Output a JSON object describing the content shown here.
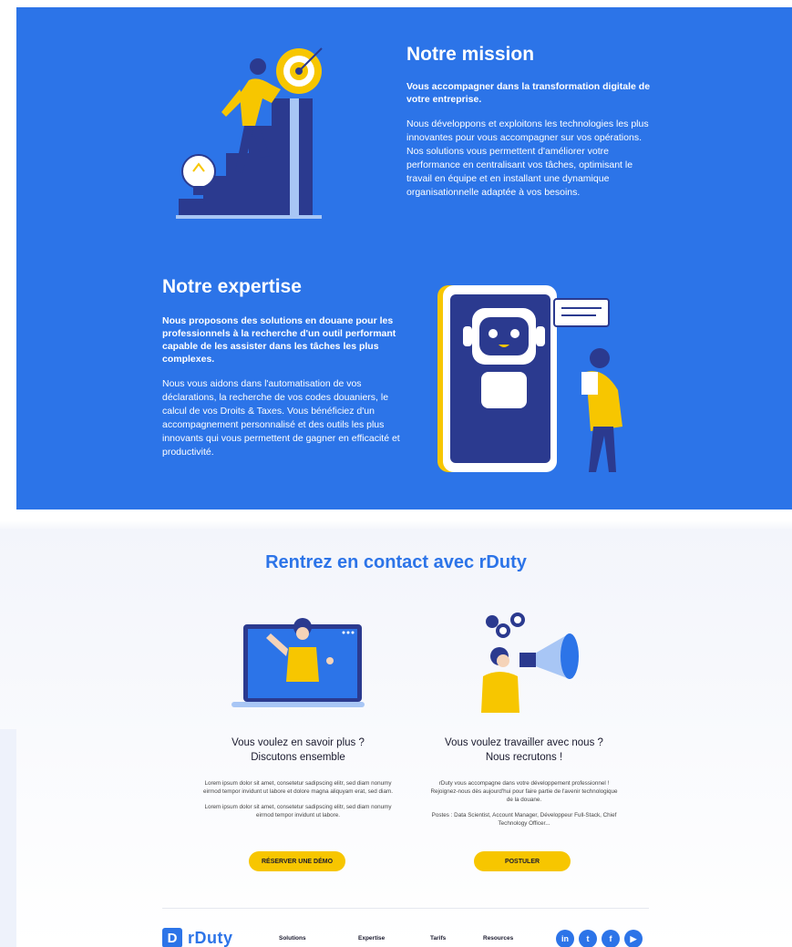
{
  "mission": {
    "title": "Notre mission",
    "lead": "Vous accompagner dans la transformation digitale de votre entreprise.",
    "body": "Nous développons et exploitons les technologies les plus innovantes pour vous accompagner sur vos opérations. Nos solutions vous permettent d'améliorer votre performance en centralisant vos tâches, optimisant le travail en équipe et en installant une dynamique organisationnelle adaptée à vos besoins."
  },
  "expertise": {
    "title": "Notre expertise",
    "lead": "Nous proposons des solutions en douane pour les professionnels à la recherche d'un outil performant capable de les assister dans les tâches les plus complexes.",
    "body": "Nous vous aidons dans l'automatisation de vos déclarations, la recherche de vos codes douaniers, le calcul de vos Droits & Taxes. Vous bénéficiez d'un accompagnement personnalisé et des outils les plus innovants qui vous permettent de gagner en efficacité et productivité."
  },
  "contact": {
    "title": "Rentrez en contact avec rDuty",
    "left": {
      "title_line1": "Vous voulez en savoir plus ?",
      "title_line2": "Discutons ensemble",
      "para1": "Lorem ipsum dolor sit amet, consetetur sadipscing elitr, sed diam nonumy eirmod tempor invidunt ut labore et dolore magna aliquyam erat, sed diam.",
      "para2": "Lorem ipsum dolor sit amet, consetetur sadipscing elitr, sed diam nonumy eirmod tempor invidunt ut labore.",
      "button": "RÉSERVER UNE DÉMO"
    },
    "right": {
      "title_line1": "Vous voulez travailler avec nous ?",
      "title_line2": "Nous recrutons !",
      "para1": "rDuty vous accompagne dans votre développement professionnel ! Rejoignez-nous dès aujourd'hui pour faire partie de l'avenir technologique de la douane.",
      "para2": "Postes : Data Scientist, Account Manager, Développeur Full-Stack, Chief Technology Officer...",
      "button": "POSTULER"
    }
  },
  "footer": {
    "logo_mark": "D",
    "logo_text": "rDuty",
    "nav": [
      "Solutions",
      "Expertise",
      "Tarifs",
      "Resources"
    ],
    "socials": [
      {
        "icon": "linkedin-icon",
        "glyph": "in"
      },
      {
        "icon": "twitter-icon",
        "glyph": "t"
      },
      {
        "icon": "facebook-icon",
        "glyph": "f"
      },
      {
        "icon": "youtube-icon",
        "glyph": "▶"
      }
    ]
  },
  "colors": {
    "brand_blue": "#2c74e8",
    "accent_yellow": "#f7c600",
    "navy": "#2b3a8f"
  }
}
